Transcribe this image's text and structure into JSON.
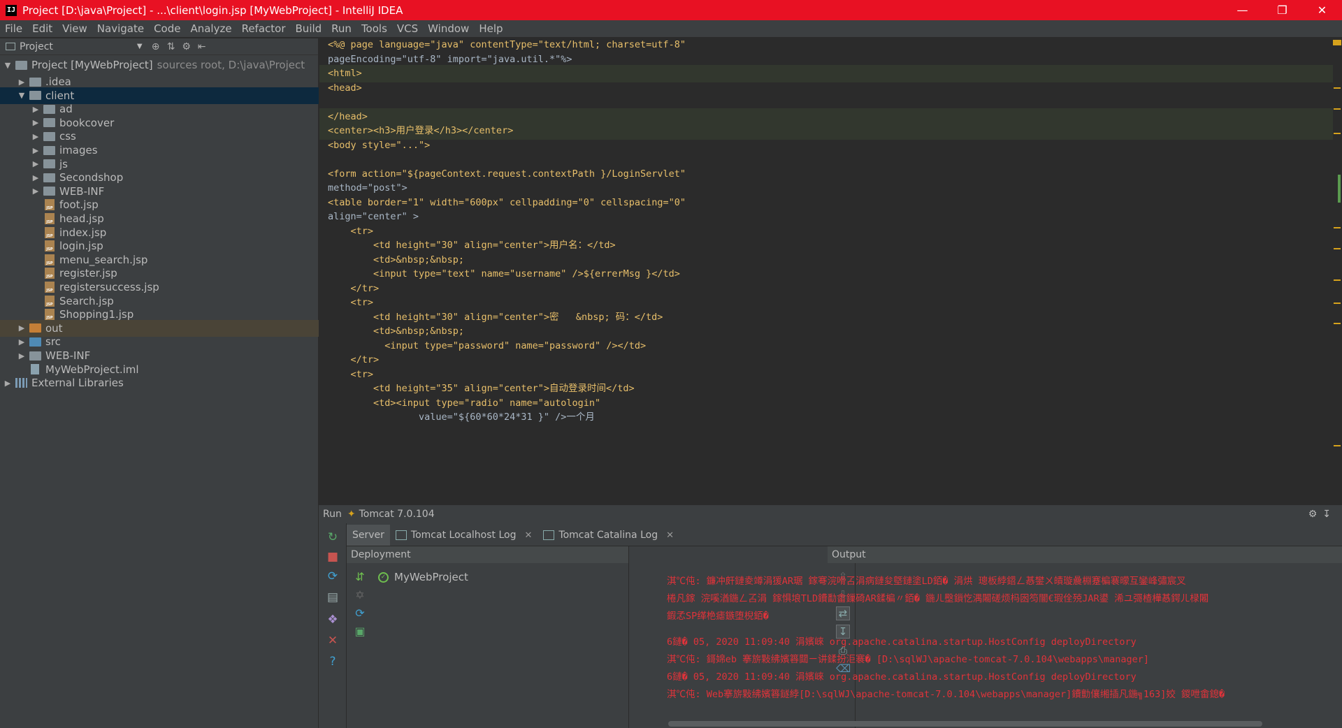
{
  "window": {
    "title": "Project [D:\\java\\Project] - ...\\client\\login.jsp [MyWebProject] - IntelliJ IDEA",
    "app_icon": "IJ",
    "controls": [
      "minimize-icon",
      "restore-icon",
      "close-icon"
    ]
  },
  "menu": [
    "File",
    "Edit",
    "View",
    "Navigate",
    "Code",
    "Analyze",
    "Refactor",
    "Build",
    "Run",
    "Tools",
    "VCS",
    "Window",
    "Help"
  ],
  "project_panel": {
    "title": "Project",
    "root": {
      "label": "Project [MyWebProject]",
      "hint": "sources root,  D:\\java\\Project"
    },
    "items": [
      {
        "label": ".idea",
        "indent": 1,
        "kind": "folder",
        "arrow": "▶"
      },
      {
        "label": "client",
        "indent": 1,
        "kind": "folder",
        "arrow": "▼",
        "selected": true
      },
      {
        "label": "ad",
        "indent": 2,
        "kind": "folder",
        "arrow": "▶"
      },
      {
        "label": "bookcover",
        "indent": 2,
        "kind": "folder",
        "arrow": "▶"
      },
      {
        "label": "css",
        "indent": 2,
        "kind": "folder",
        "arrow": "▶"
      },
      {
        "label": "images",
        "indent": 2,
        "kind": "folder",
        "arrow": "▶"
      },
      {
        "label": "js",
        "indent": 2,
        "kind": "folder",
        "arrow": "▶"
      },
      {
        "label": "Secondshop",
        "indent": 2,
        "kind": "folder",
        "arrow": "▶"
      },
      {
        "label": "WEB-INF",
        "indent": 2,
        "kind": "folder",
        "arrow": "▶"
      },
      {
        "label": "foot.jsp",
        "indent": 2,
        "kind": "jsp",
        "arrow": ""
      },
      {
        "label": "head.jsp",
        "indent": 2,
        "kind": "jsp",
        "arrow": ""
      },
      {
        "label": "index.jsp",
        "indent": 2,
        "kind": "jsp",
        "arrow": ""
      },
      {
        "label": "login.jsp",
        "indent": 2,
        "kind": "jsp",
        "arrow": ""
      },
      {
        "label": "menu_search.jsp",
        "indent": 2,
        "kind": "jsp",
        "arrow": ""
      },
      {
        "label": "register.jsp",
        "indent": 2,
        "kind": "jsp",
        "arrow": ""
      },
      {
        "label": "registersuccess.jsp",
        "indent": 2,
        "kind": "jsp",
        "arrow": ""
      },
      {
        "label": "Search.jsp",
        "indent": 2,
        "kind": "jsp",
        "arrow": ""
      },
      {
        "label": "Shopping1.jsp",
        "indent": 2,
        "kind": "jsp",
        "arrow": ""
      },
      {
        "label": "out",
        "indent": 1,
        "kind": "folder-orange",
        "arrow": "▶",
        "highlight": true
      },
      {
        "label": "src",
        "indent": 1,
        "kind": "folder-blue",
        "arrow": "▶"
      },
      {
        "label": "WEB-INF",
        "indent": 1,
        "kind": "folder",
        "arrow": "▶"
      },
      {
        "label": "MyWebProject.iml",
        "indent": 1,
        "kind": "iml",
        "arrow": ""
      },
      {
        "label": "External Libraries",
        "indent": 0,
        "kind": "lib",
        "arrow": "▶"
      }
    ]
  },
  "editor": {
    "lines": [
      "<%@ page language=\"java\" contentType=\"text/html; charset=utf-8\"",
      "pageEncoding=\"utf-8\" import=\"java.util.*\"%>",
      "<html>",
      "<head>",
      "",
      "</head>",
      "<center><h3>用户登录</h3></center>",
      "<body style=\"...\">",
      "",
      "<form action=\"${pageContext.request.contextPath }/LoginServlet\"",
      "method=\"post\">",
      "<table border=\"1\" width=\"600px\" cellpadding=\"0\" cellspacing=\"0\"",
      "align=\"center\" >",
      "    <tr>",
      "        <td height=\"30\" align=\"center\">用户名：</td>",
      "        <td>&nbsp;&nbsp;",
      "        <input type=\"text\" name=\"username\" />${errerMsg }</td>",
      "    </tr>",
      "    <tr>",
      "        <td height=\"30\" align=\"center\">密   &nbsp; 码：</td>",
      "        <td>&nbsp;&nbsp;",
      "          <input type=\"password\" name=\"password\" /></td>",
      "    </tr>",
      "    <tr>",
      "        <td height=\"35\" align=\"center\">自动登录时间</td>",
      "        <td><input type=\"radio\" name=\"autologin\"",
      "                value=\"${60*60*24*31 }\" />一个月"
    ]
  },
  "run": {
    "label": "Run",
    "config": "Tomcat 7.0.104",
    "tabs": [
      {
        "label": "Server",
        "closable": false
      },
      {
        "label": "Tomcat Localhost Log",
        "closable": true
      },
      {
        "label": "Tomcat Catalina Log",
        "closable": true
      }
    ],
    "deployment_header": "Deployment",
    "output_header": "Output",
    "artifact": "MyWebProject",
    "output_lines": [
      "淇℃伅: 鐮冲皯鏈夌竴涓猨AR琚  鎵弿浣嗗叾涓病鏈夋墍鏈塗LD銆� 涓烘  璁板綍鍣ㄥ惎鐢ㄨ皟璇曟棩蹇楄褰曚互鑾峰彇宸叉  ",
      " 棬凡鎵  浣嗘湭鍦ㄥ叾涓  鎵惧埌TLD鐨勫畬鏁碕AR鍒楄〃銆� 鍦ㄦ壂鎻忔湡闂磋烦杩囦笉闇€瑕佺殑JAR鍙  浠ユ彁楂樺惎鍔ㄦ椂闂",
      " 鍜孞SP缂栬瘧鏃堕棿銆�",
      "6鏈� 05, 2020 11:09:40 涓嬪崍 org.apache.catalina.startup.HostConfig deployDirectory",
      "淇℃伅: 鎶婂eb 搴旂敤绋嬪簭閮ㄧ讲鍒扮洰褰� [D:\\sqlWJ\\apache-tomcat-7.0.104\\webapps\\manager]",
      "6鏈� 05, 2020 11:09:40 涓嬪崍 org.apache.catalina.startup.HostConfig deployDirectory",
      "淇℃伅: Web搴旂敤绋嬪簭鐩綍[D:\\sqlWJ\\apache-tomcat-7.0.104\\webapps\\manager]鐨勯儴缃插凡鍦╗163]姣  鍐呭畬鎴�"
    ]
  },
  "colors": {
    "titlebar": "#e81123",
    "panel": "#3c3f41",
    "editor_bg": "#2b2b2b",
    "tag": "#e8bf6a",
    "string": "#6a8759",
    "error_text": "#e0333a",
    "selection": "#0d293e"
  }
}
